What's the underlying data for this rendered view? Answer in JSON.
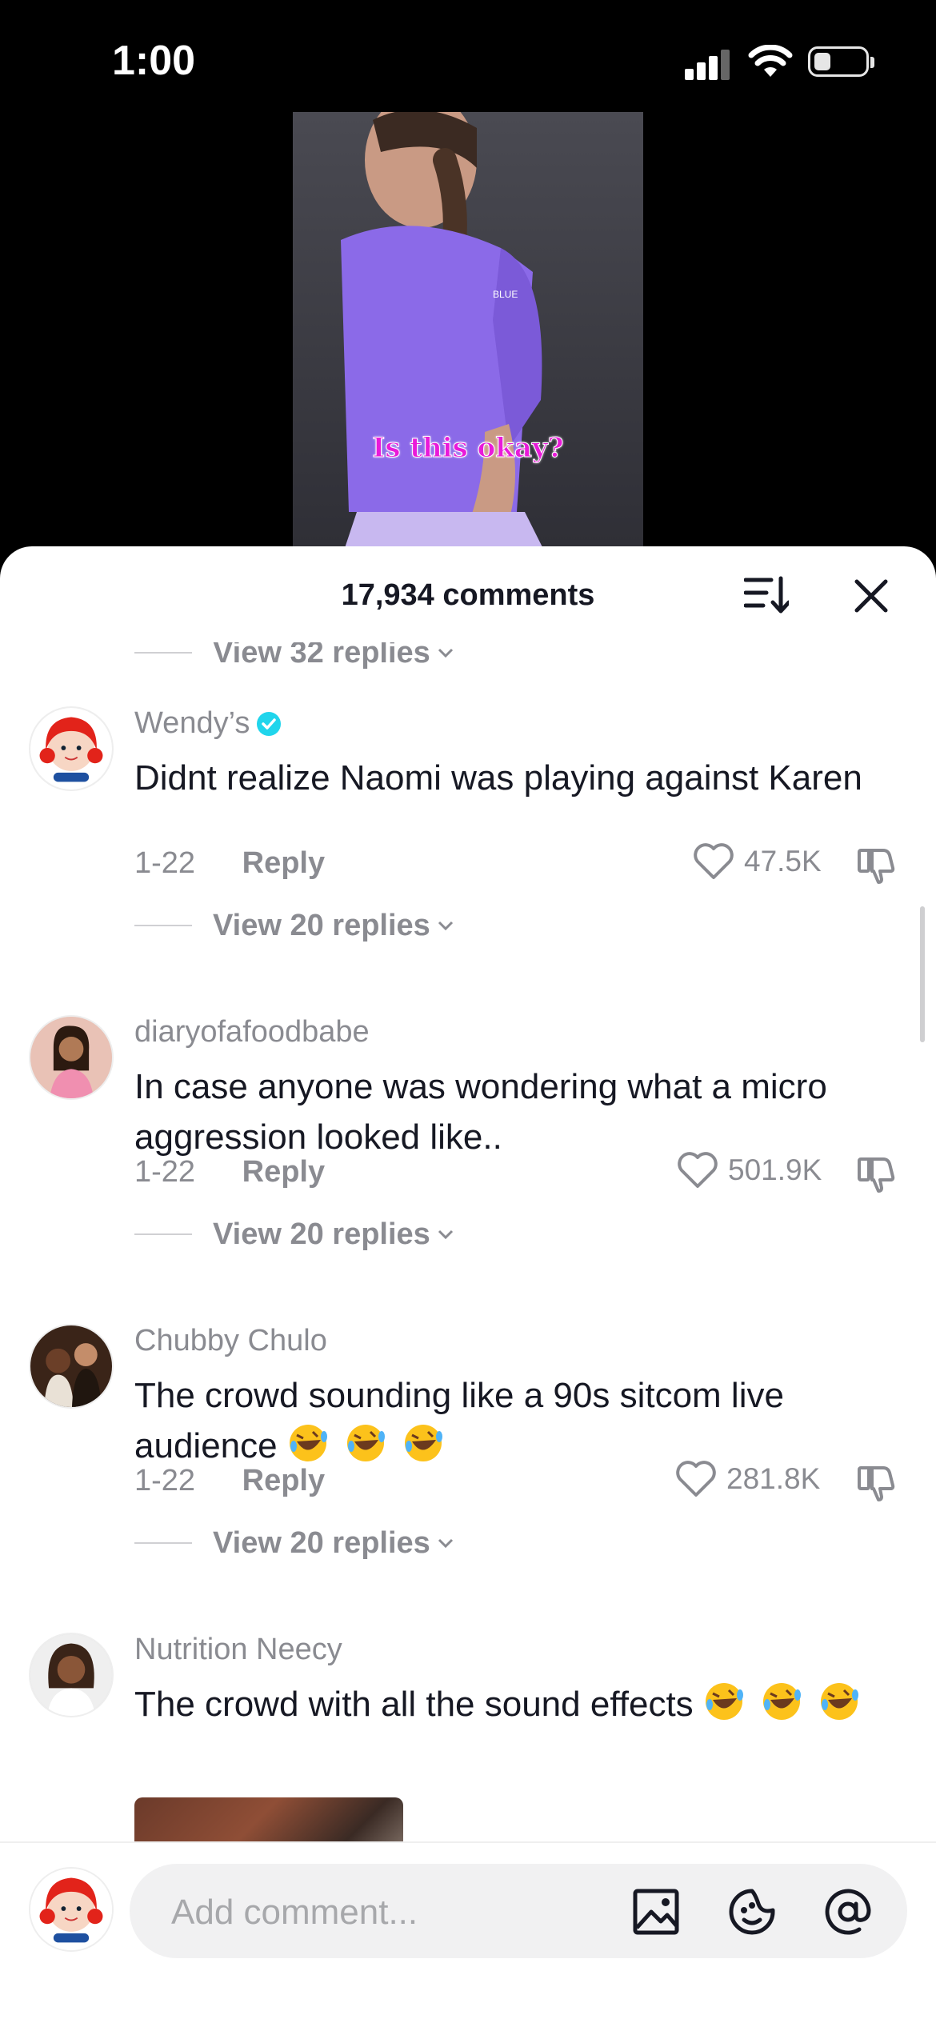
{
  "status_bar": {
    "time": "1:00"
  },
  "video": {
    "caption": "Is this okay?"
  },
  "header": {
    "comment_count": "17,934 comments"
  },
  "comments": [
    {
      "username": "Wendy’s",
      "verified": true,
      "text": "Didnt realize Naomi was playing against Karen",
      "date": "1-22",
      "reply_label": "Reply",
      "likes": "47.5K",
      "view_replies": "View 20 replies"
    },
    {
      "username": "diaryofafoodbabe",
      "verified": false,
      "text": "In case anyone was wondering what a micro aggression looked like..",
      "date": "1-22",
      "reply_label": "Reply",
      "likes": "501.9K",
      "view_replies": "View 20 replies"
    },
    {
      "username": "Chubby Chulo",
      "verified": false,
      "text": "The crowd sounding like a 90s sitcom live audience",
      "date": "1-22",
      "reply_label": "Reply",
      "likes": "281.8K",
      "view_replies": "View 20 replies"
    },
    {
      "username": "Nutrition Neecy",
      "verified": false,
      "text": "The crowd with all the sound effects",
      "date": "",
      "reply_label": "",
      "likes": "",
      "view_replies": ""
    }
  ],
  "top_partial": {
    "view_replies": "View 32 replies"
  },
  "input": {
    "placeholder": "Add comment..."
  },
  "colors": {
    "verified": "#20d5ec",
    "caption": "#e91ad9",
    "jersey": "#8b6ae8"
  },
  "icons": [
    "sort-icon",
    "close-icon",
    "heart-icon",
    "dislike-icon",
    "verified-badge-icon",
    "laughing-emoji-icon",
    "image-icon",
    "sticker-icon",
    "mention-icon"
  ]
}
